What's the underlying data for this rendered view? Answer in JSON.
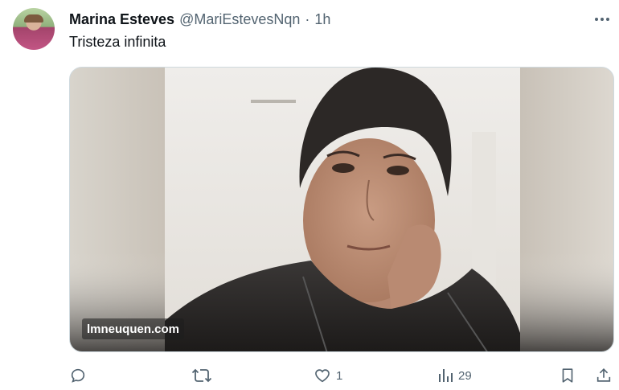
{
  "author": {
    "name": "Marina Esteves",
    "handle": "@MariEstevesNqn",
    "separator": "·",
    "time": "1h"
  },
  "tweet": {
    "text": "Tristeza infinita",
    "media": {
      "watermark": "lmneuquen.com"
    }
  },
  "actions": {
    "reply": {
      "icon": "reply-icon",
      "count": ""
    },
    "retweet": {
      "icon": "retweet-icon",
      "count": ""
    },
    "like": {
      "icon": "heart-icon",
      "count": "1"
    },
    "views": {
      "icon": "views-icon",
      "count": "29"
    },
    "bookmark": {
      "icon": "bookmark-icon"
    },
    "share": {
      "icon": "share-icon"
    }
  },
  "colors": {
    "text_primary": "#0f1419",
    "text_secondary": "#536471",
    "border": "#cfd9de"
  }
}
